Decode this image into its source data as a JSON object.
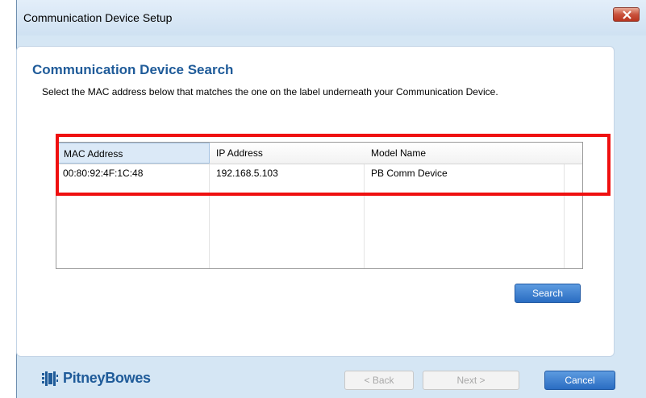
{
  "window": {
    "title": "Communication Device Setup",
    "close_icon": "close-icon"
  },
  "page": {
    "heading": "Communication Device Search",
    "instruction": "Select the MAC address below that matches the one on the label underneath your Communication Device."
  },
  "table": {
    "columns": [
      "MAC Address",
      "IP Address",
      "Model Name"
    ],
    "rows": [
      [
        "00:80:92:4F:1C:48",
        "192.168.5.103",
        "PB Comm Device"
      ]
    ]
  },
  "buttons": {
    "search": "Search",
    "back": "< Back",
    "next": "Next >",
    "cancel": "Cancel"
  },
  "brand": {
    "name": "PitneyBowes",
    "icon": "pitney-bowes-logo-icon",
    "color": "#1f5b99"
  },
  "colors": {
    "highlight": "#ef1010",
    "accent": "#2a6dc2"
  }
}
